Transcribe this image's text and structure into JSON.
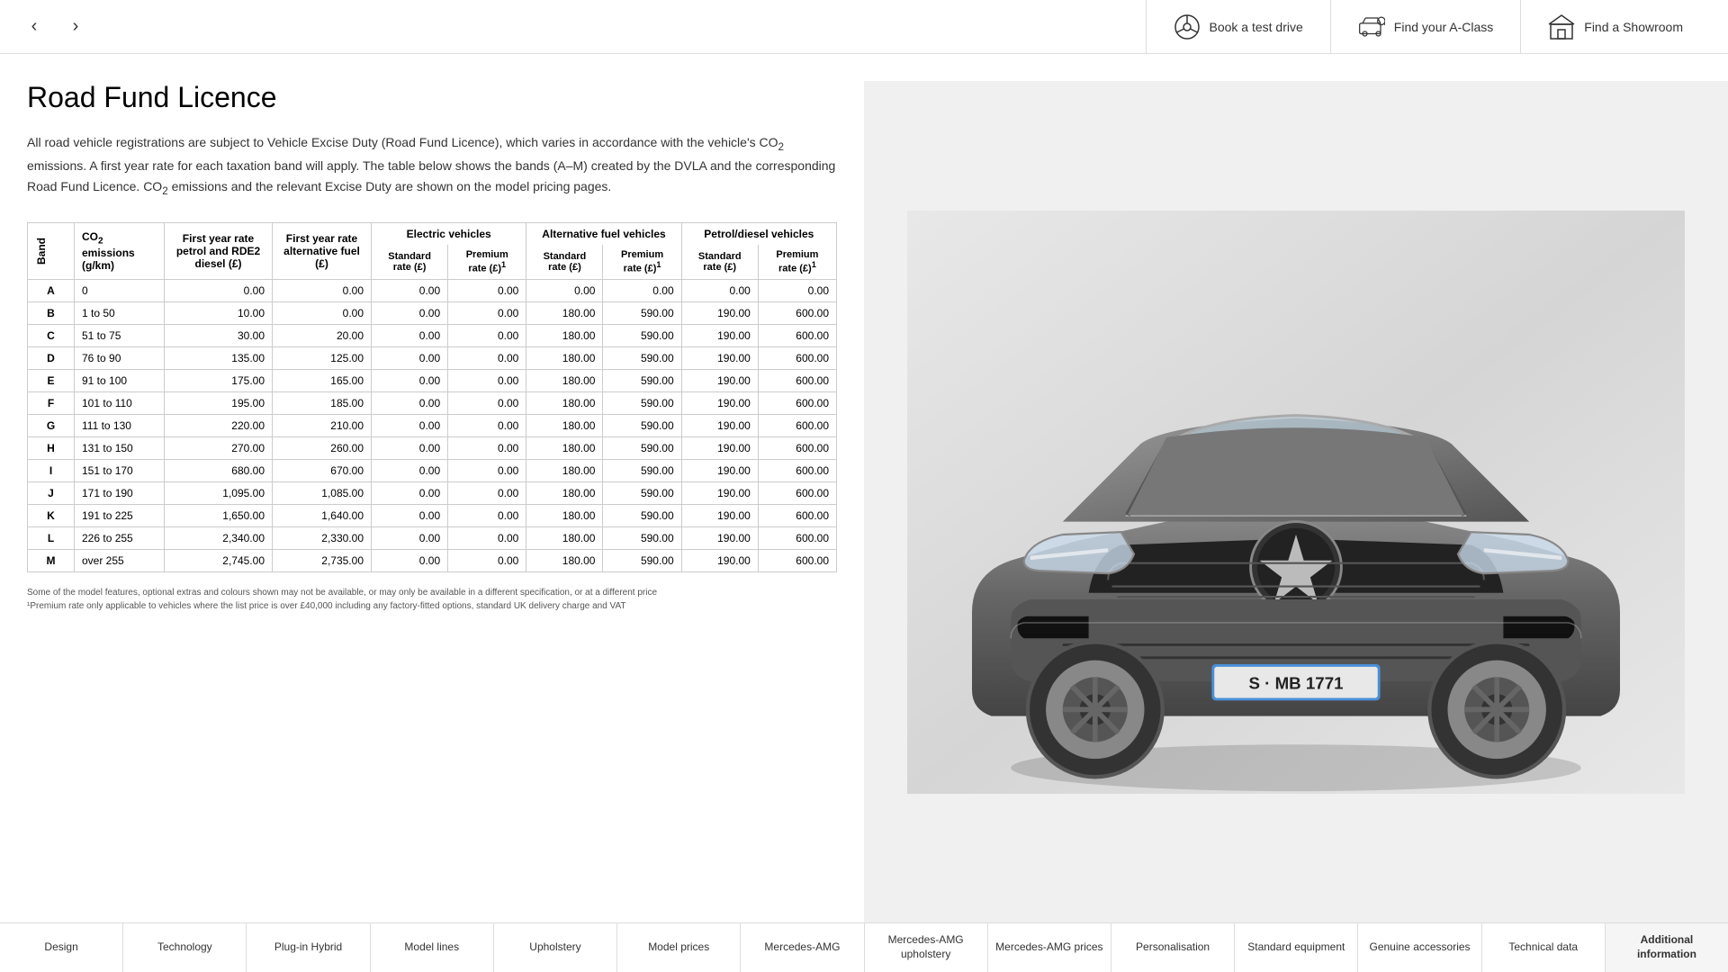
{
  "header": {
    "book_test_drive": "Book a test drive",
    "find_a_class": "Find your A-Class",
    "find_showroom": "Find a Showroom"
  },
  "page": {
    "title": "Road Fund Licence",
    "description_1": "All road vehicle registrations are subject to Vehicle Excise Duty (Road Fund Licence), which varies in accordance with the vehicle's CO",
    "description_2": " emissions. A first year rate for each taxation band will apply. The table below shows the bands (A–M) created by the DVLA and the corresponding Road Fund Licence. CO",
    "description_3": " emissions and the relevant Excise Duty are shown on the model pricing pages."
  },
  "table": {
    "col_band": "Band",
    "col_co2": "CO₂ emissions (g/km)",
    "col_first_year_petrol": "First year rate petrol and RDE2 diesel (£)",
    "col_first_year_alt": "First year rate alternative fuel (£)",
    "group_electric": "Electric vehicles",
    "group_alt_fuel": "Alternative fuel vehicles",
    "group_petrol_diesel": "Petrol/diesel vehicles",
    "sub_standard": "Standard rate (£)",
    "sub_premium": "Premium rate (£)¹",
    "rows": [
      {
        "band": "A",
        "co2": "0",
        "petrol": "0.00",
        "alt_fuel": "0.00",
        "ev_std": "0.00",
        "ev_prem": "0.00",
        "afv_std": "0.00",
        "afv_prem": "0.00",
        "pd_std": "0.00",
        "pd_prem": "0.00"
      },
      {
        "band": "B",
        "co2": "1 to 50",
        "petrol": "10.00",
        "alt_fuel": "0.00",
        "ev_std": "0.00",
        "ev_prem": "0.00",
        "afv_std": "180.00",
        "afv_prem": "590.00",
        "pd_std": "190.00",
        "pd_prem": "600.00"
      },
      {
        "band": "C",
        "co2": "51 to 75",
        "petrol": "30.00",
        "alt_fuel": "20.00",
        "ev_std": "0.00",
        "ev_prem": "0.00",
        "afv_std": "180.00",
        "afv_prem": "590.00",
        "pd_std": "190.00",
        "pd_prem": "600.00"
      },
      {
        "band": "D",
        "co2": "76 to 90",
        "petrol": "135.00",
        "alt_fuel": "125.00",
        "ev_std": "0.00",
        "ev_prem": "0.00",
        "afv_std": "180.00",
        "afv_prem": "590.00",
        "pd_std": "190.00",
        "pd_prem": "600.00"
      },
      {
        "band": "E",
        "co2": "91 to 100",
        "petrol": "175.00",
        "alt_fuel": "165.00",
        "ev_std": "0.00",
        "ev_prem": "0.00",
        "afv_std": "180.00",
        "afv_prem": "590.00",
        "pd_std": "190.00",
        "pd_prem": "600.00"
      },
      {
        "band": "F",
        "co2": "101 to 110",
        "petrol": "195.00",
        "alt_fuel": "185.00",
        "ev_std": "0.00",
        "ev_prem": "0.00",
        "afv_std": "180.00",
        "afv_prem": "590.00",
        "pd_std": "190.00",
        "pd_prem": "600.00"
      },
      {
        "band": "G",
        "co2": "111 to 130",
        "petrol": "220.00",
        "alt_fuel": "210.00",
        "ev_std": "0.00",
        "ev_prem": "0.00",
        "afv_std": "180.00",
        "afv_prem": "590.00",
        "pd_std": "190.00",
        "pd_prem": "600.00"
      },
      {
        "band": "H",
        "co2": "131 to 150",
        "petrol": "270.00",
        "alt_fuel": "260.00",
        "ev_std": "0.00",
        "ev_prem": "0.00",
        "afv_std": "180.00",
        "afv_prem": "590.00",
        "pd_std": "190.00",
        "pd_prem": "600.00"
      },
      {
        "band": "I",
        "co2": "151 to 170",
        "petrol": "680.00",
        "alt_fuel": "670.00",
        "ev_std": "0.00",
        "ev_prem": "0.00",
        "afv_std": "180.00",
        "afv_prem": "590.00",
        "pd_std": "190.00",
        "pd_prem": "600.00"
      },
      {
        "band": "J",
        "co2": "171 to 190",
        "petrol": "1,095.00",
        "alt_fuel": "1,085.00",
        "ev_std": "0.00",
        "ev_prem": "0.00",
        "afv_std": "180.00",
        "afv_prem": "590.00",
        "pd_std": "190.00",
        "pd_prem": "600.00"
      },
      {
        "band": "K",
        "co2": "191 to 225",
        "petrol": "1,650.00",
        "alt_fuel": "1,640.00",
        "ev_std": "0.00",
        "ev_prem": "0.00",
        "afv_std": "180.00",
        "afv_prem": "590.00",
        "pd_std": "190.00",
        "pd_prem": "600.00"
      },
      {
        "band": "L",
        "co2": "226 to 255",
        "petrol": "2,340.00",
        "alt_fuel": "2,330.00",
        "ev_std": "0.00",
        "ev_prem": "0.00",
        "afv_std": "180.00",
        "afv_prem": "590.00",
        "pd_std": "190.00",
        "pd_prem": "600.00"
      },
      {
        "band": "M",
        "co2": "over 255",
        "petrol": "2,745.00",
        "alt_fuel": "2,735.00",
        "ev_std": "0.00",
        "ev_prem": "0.00",
        "afv_std": "180.00",
        "afv_prem": "590.00",
        "pd_std": "190.00",
        "pd_prem": "600.00"
      }
    ]
  },
  "footnotes": {
    "line1": "Some of the model features, optional extras and colours shown may not be available, or may only be available in a different specification, or at a different price",
    "line2": "¹Premium rate only applicable to vehicles where the list price is over £40,000 including any factory-fitted options, standard UK delivery charge and VAT"
  },
  "bottom_nav": [
    {
      "label": "Design",
      "active": false
    },
    {
      "label": "Technology",
      "active": false
    },
    {
      "label": "Plug-in Hybrid",
      "active": false
    },
    {
      "label": "Model lines",
      "active": false
    },
    {
      "label": "Upholstery",
      "active": false
    },
    {
      "label": "Model prices",
      "active": false
    },
    {
      "label": "Mercedes-AMG",
      "active": false
    },
    {
      "label": "Mercedes-AMG upholstery",
      "active": false
    },
    {
      "label": "Mercedes-AMG prices",
      "active": false
    },
    {
      "label": "Personalisation",
      "active": false
    },
    {
      "label": "Standard equipment",
      "active": false
    },
    {
      "label": "Genuine accessories",
      "active": false
    },
    {
      "label": "Technical data",
      "active": false
    },
    {
      "label": "Additional information",
      "active": true
    }
  ]
}
